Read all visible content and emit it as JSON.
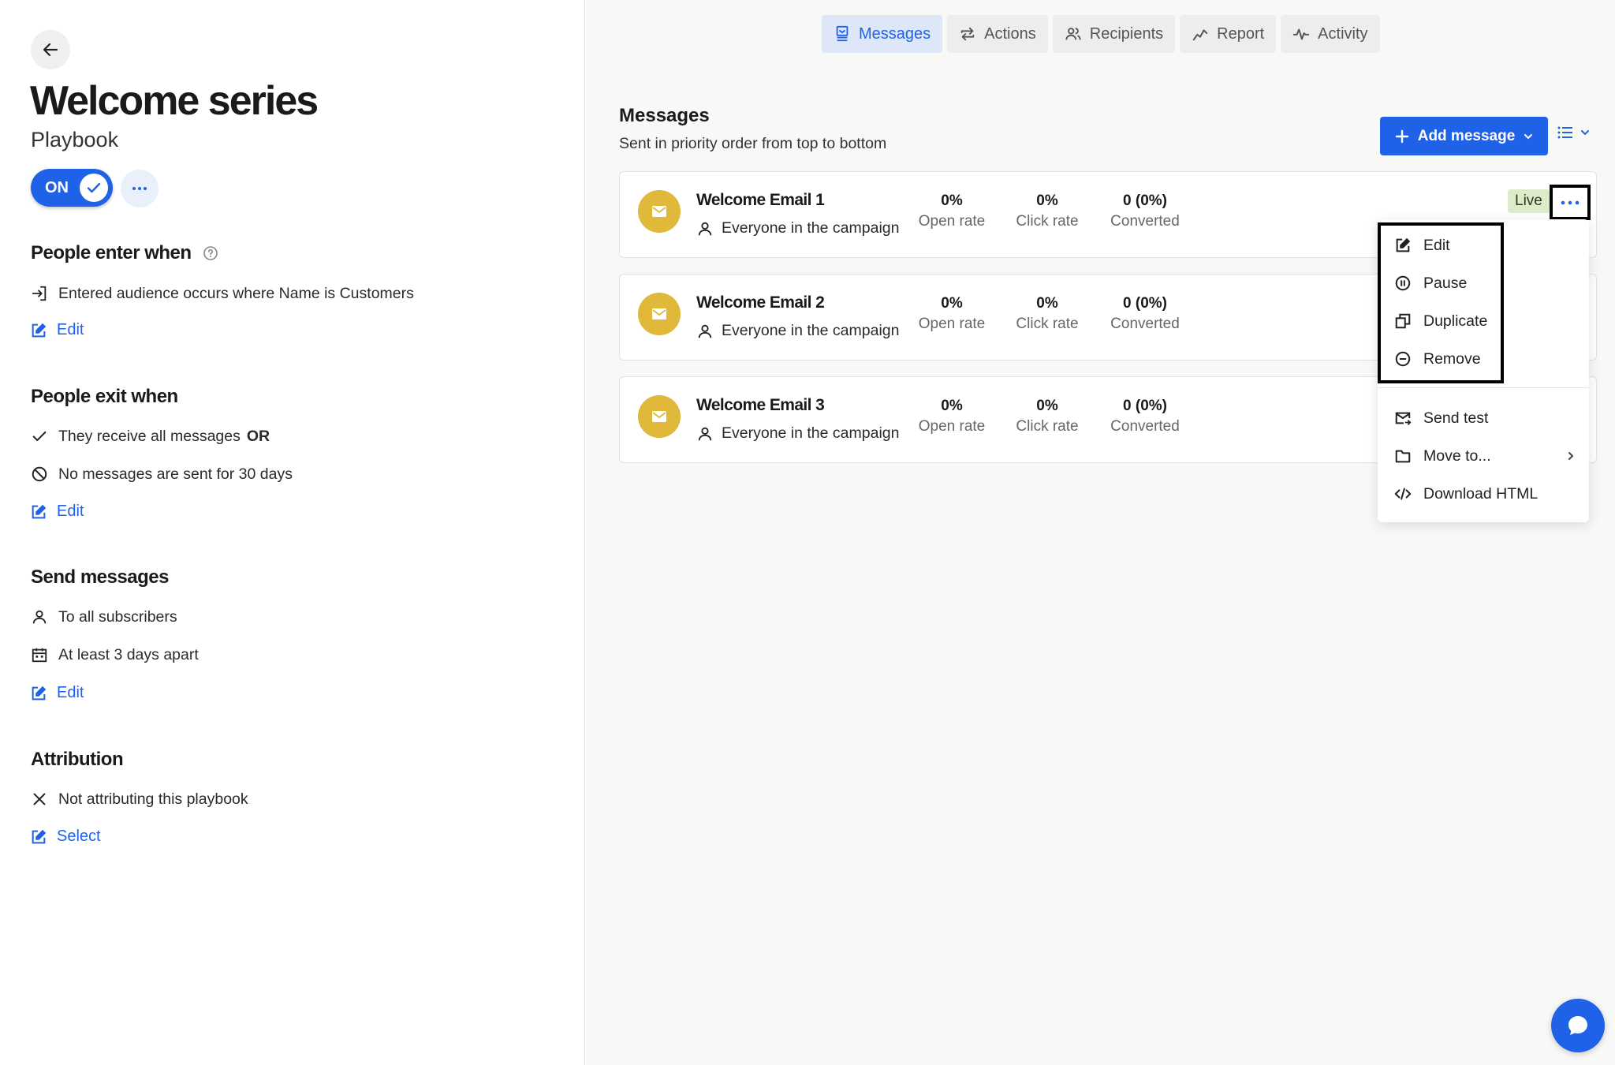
{
  "header": {
    "title": "Welcome series",
    "subtitle": "Playbook",
    "toggle_label": "ON"
  },
  "enter": {
    "title": "People enter when",
    "condition": "Entered audience occurs where Name is Customers",
    "edit_label": "Edit"
  },
  "exit": {
    "title": "People exit when",
    "cond1_text": "They receive all messages",
    "cond1_op": "OR",
    "cond2_text": "No messages are sent for 30 days",
    "edit_label": "Edit"
  },
  "send": {
    "title": "Send messages",
    "to": "To all subscribers",
    "spacing": "At least 3 days apart",
    "edit_label": "Edit"
  },
  "attribution": {
    "title": "Attribution",
    "status": "Not attributing this playbook",
    "select_label": "Select"
  },
  "tabs": [
    {
      "label": "Messages",
      "icon": "message-icon",
      "active": true
    },
    {
      "label": "Actions",
      "icon": "repeat-icon",
      "active": false
    },
    {
      "label": "Recipients",
      "icon": "people-icon",
      "active": false
    },
    {
      "label": "Report",
      "icon": "trend-icon",
      "active": false
    },
    {
      "label": "Activity",
      "icon": "pulse-icon",
      "active": false
    }
  ],
  "messages": {
    "title": "Messages",
    "subtitle": "Sent in priority order from top to bottom",
    "add_label": "Add message",
    "stat_labels": {
      "open": "Open rate",
      "click": "Click rate",
      "converted": "Converted"
    },
    "items": [
      {
        "name": "Welcome Email 1",
        "audience": "Everyone in the campaign",
        "open": "0%",
        "click": "0%",
        "converted": "0 (0%)",
        "status": "Live"
      },
      {
        "name": "Welcome Email 2",
        "audience": "Everyone in the campaign",
        "open": "0%",
        "click": "0%",
        "converted": "0 (0%)"
      },
      {
        "name": "Welcome Email 3",
        "audience": "Everyone in the campaign",
        "open": "0%",
        "click": "0%",
        "converted": "0 (0%)"
      }
    ]
  },
  "menu": {
    "items": [
      {
        "label": "Edit",
        "icon": "edit-icon"
      },
      {
        "label": "Pause",
        "icon": "pause-icon"
      },
      {
        "label": "Duplicate",
        "icon": "duplicate-icon"
      },
      {
        "label": "Remove",
        "icon": "remove-icon"
      },
      {
        "label": "Send test",
        "icon": "send-test-icon"
      },
      {
        "label": "Move to...",
        "icon": "folder-icon"
      },
      {
        "label": "Download HTML",
        "icon": "code-icon"
      }
    ]
  },
  "colors": {
    "accent": "#1f62e8",
    "avatar": "#e0b83a",
    "live_bg": "#dcebc9"
  }
}
